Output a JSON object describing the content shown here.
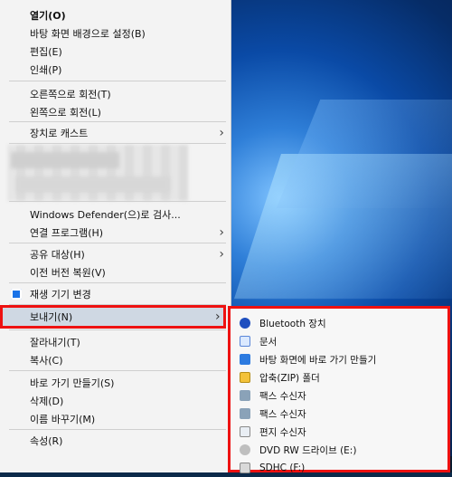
{
  "context_menu": {
    "items": [
      {
        "label": "열기(O)",
        "bold": true
      },
      {
        "label": "바탕 화면 배경으로 설정(B)"
      },
      {
        "label": "편집(E)"
      },
      {
        "label": "인쇄(P)"
      },
      {
        "label": "오른쪽으로 회전(T)"
      },
      {
        "label": "왼쪽으로 회전(L)"
      },
      {
        "label": "장치로 캐스트",
        "has_submenu": true
      },
      {
        "label": "Windows Defender(으)로 검사..."
      },
      {
        "label": "연결 프로그램(H)",
        "has_submenu": true
      },
      {
        "label": "공유 대상(H)",
        "has_submenu": true
      },
      {
        "label": "이전 버전 복원(V)"
      },
      {
        "label": "재생 기기 변경"
      },
      {
        "label": "보내기(N)",
        "has_submenu": true,
        "highlighted": true
      },
      {
        "label": "잘라내기(T)"
      },
      {
        "label": "복사(C)"
      },
      {
        "label": "바로 가기 만들기(S)"
      },
      {
        "label": "삭제(D)"
      },
      {
        "label": "이름 바꾸기(M)"
      },
      {
        "label": "속성(R)"
      }
    ],
    "icons": {
      "playback_device": "blue-circle-icon"
    },
    "submenu_arrow": "›"
  },
  "send_to_menu": {
    "items": [
      {
        "label": "Bluetooth 장치",
        "icon": "bluetooth-icon"
      },
      {
        "label": "문서",
        "icon": "document-icon"
      },
      {
        "label": "바탕 화면에 바로 가기 만들기",
        "icon": "desktop-icon"
      },
      {
        "label": "압축(ZIP) 폴더",
        "icon": "zip-folder-icon"
      },
      {
        "label": "팩스 수신자",
        "icon": "fax-icon"
      },
      {
        "label": "팩스 수신자",
        "icon": "fax-icon"
      },
      {
        "label": "편지 수신자",
        "icon": "mail-icon"
      },
      {
        "label": "DVD RW 드라이브 (E:)",
        "icon": "dvd-drive-icon"
      },
      {
        "label": "SDHC (F:)",
        "icon": "sd-card-icon"
      }
    ]
  },
  "colors": {
    "highlight_border": "#e11",
    "menu_bg": "#f3f3f3",
    "submenu_bg": "#f7f7f7"
  }
}
